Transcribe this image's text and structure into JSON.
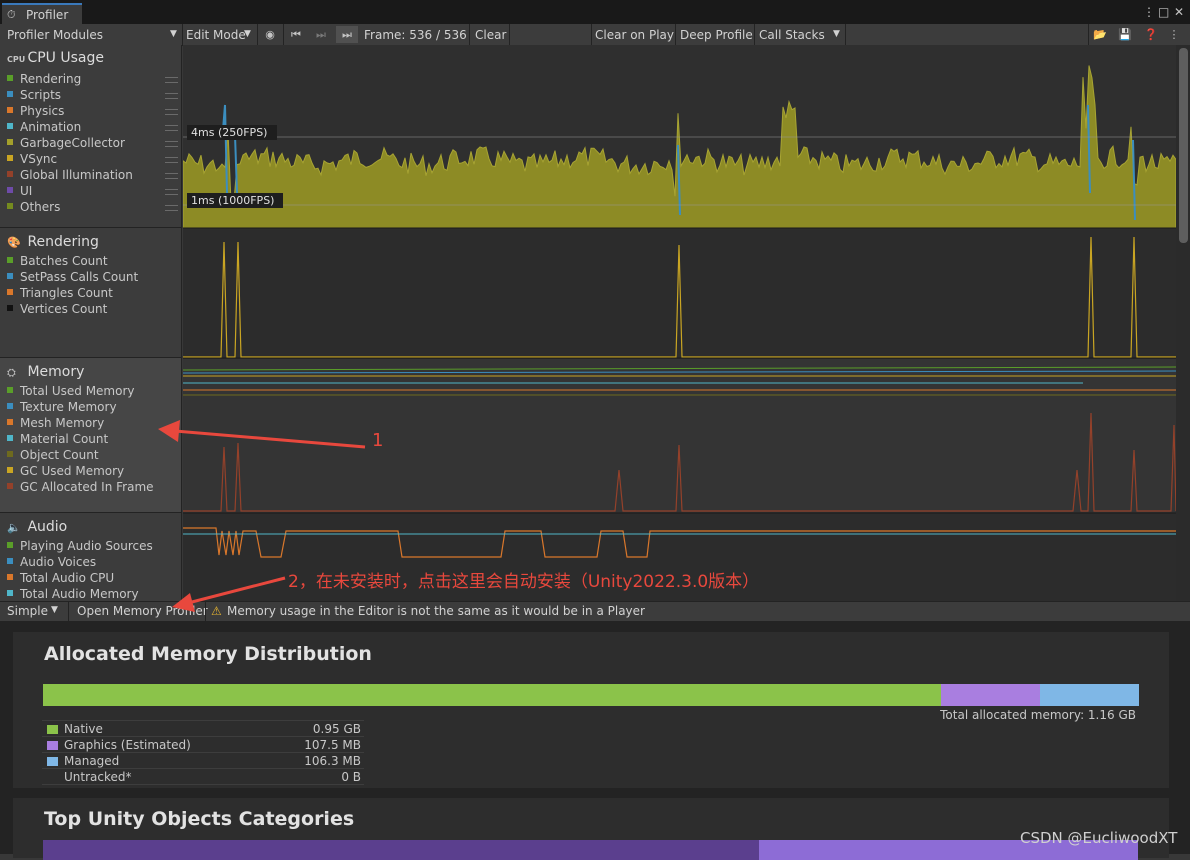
{
  "window": {
    "tab_title": "Profiler",
    "menu_icon": "kebab-menu-icon",
    "maximize_icon": "maximize-icon",
    "close_icon": "close-icon"
  },
  "toolbar": {
    "modules_dropdown": "Profiler Modules",
    "mode_dropdown": "Edit Mode",
    "frame_label": "Frame: 536 / 536",
    "clear": "Clear",
    "clear_on_play": "Clear on Play",
    "deep_profile": "Deep Profile",
    "call_stacks": "Call Stacks"
  },
  "modules": {
    "cpu": {
      "title": "CPU Usage",
      "icon_text": "CPU",
      "items": [
        {
          "label": "Rendering",
          "color": "#5a9e29"
        },
        {
          "label": "Scripts",
          "color": "#3b8ebf"
        },
        {
          "label": "Physics",
          "color": "#d9772b"
        },
        {
          "label": "Animation",
          "color": "#4fb6c9"
        },
        {
          "label": "GarbageCollector",
          "color": "#a4a02b"
        },
        {
          "label": "VSync",
          "color": "#c9a523"
        },
        {
          "label": "Global Illumination",
          "color": "#94412a"
        },
        {
          "label": "UI",
          "color": "#6e4ba8"
        },
        {
          "label": "Others",
          "color": "#758b1f"
        }
      ],
      "marker_4ms": "4ms (250FPS)",
      "marker_1ms": "1ms (1000FPS)"
    },
    "rendering": {
      "title": "Rendering",
      "items": [
        {
          "label": "Batches Count",
          "color": "#5a9e29"
        },
        {
          "label": "SetPass Calls Count",
          "color": "#3b8ebf"
        },
        {
          "label": "Triangles Count",
          "color": "#d9772b"
        },
        {
          "label": "Vertices Count",
          "color": "#111111"
        }
      ]
    },
    "memory": {
      "title": "Memory",
      "items": [
        {
          "label": "Total Used Memory",
          "color": "#5a9e29"
        },
        {
          "label": "Texture Memory",
          "color": "#3b8ebf"
        },
        {
          "label": "Mesh Memory",
          "color": "#d9772b"
        },
        {
          "label": "Material Count",
          "color": "#4fb6c9"
        },
        {
          "label": "Object Count",
          "color": "#6e6a1e"
        },
        {
          "label": "GC Used Memory",
          "color": "#c9a523"
        },
        {
          "label": "GC Allocated In Frame",
          "color": "#94412a"
        }
      ]
    },
    "audio": {
      "title": "Audio",
      "items": [
        {
          "label": "Playing Audio Sources",
          "color": "#5a9e29"
        },
        {
          "label": "Audio Voices",
          "color": "#3b8ebf"
        },
        {
          "label": "Total Audio CPU",
          "color": "#d9772b"
        },
        {
          "label": "Total Audio Memory",
          "color": "#4fb6c9"
        }
      ]
    }
  },
  "bottom_bar": {
    "view_dropdown": "Simple",
    "open_memory_profiler": "Open Memory Profiler",
    "warning": "Memory usage in the Editor is not the same as it would be in a Player"
  },
  "details": {
    "allocated_title": "Allocated Memory Distribution",
    "total_label": "Total allocated memory: 1.16 GB",
    "distribution": [
      {
        "label": "Native",
        "value": "0.95 GB",
        "color": "#8bc34a",
        "fraction": 0.82
      },
      {
        "label": "Graphics (Estimated)",
        "value": "107.5 MB",
        "color": "#a97ee0",
        "fraction": 0.09
      },
      {
        "label": "Managed",
        "value": "106.3 MB",
        "color": "#7fb7e6",
        "fraction": 0.09
      },
      {
        "label": "Untracked*",
        "value": "0 B",
        "color": "",
        "fraction": 0
      }
    ],
    "top_objects_title": "Top Unity Objects Categories"
  },
  "annotations": {
    "label_1": "1",
    "label_2": "2，在未安装时，点击这里会自动安装（Unity2022.3.0版本）",
    "watermark": "CSDN @EucliwoodXT",
    "arrow_color": "#e8483d"
  }
}
